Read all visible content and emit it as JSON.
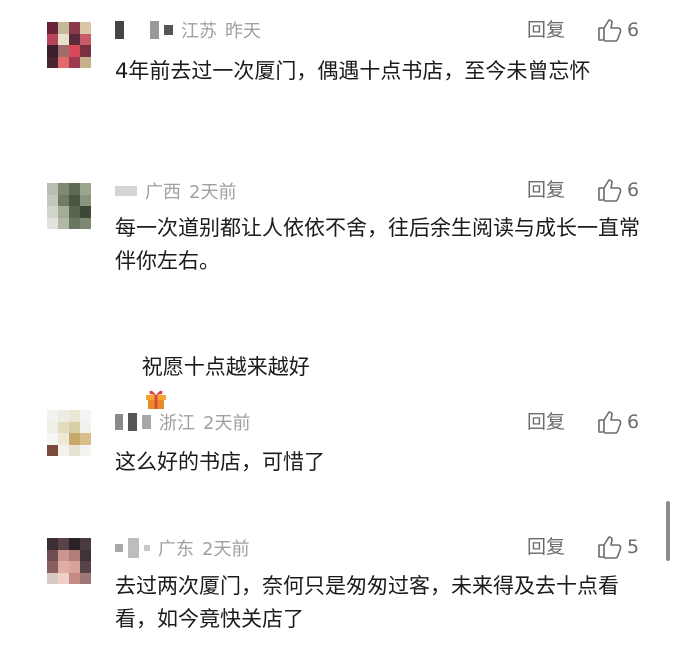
{
  "comments": [
    {
      "location": "江苏",
      "time": "昨天",
      "reply_label": "回复",
      "likes": "6",
      "text": "4年前去过一次厦门，偶遇十点书店，至今未曾忘怀"
    },
    {
      "location": "广西",
      "time": "2天前",
      "reply_label": "回复",
      "likes": "6",
      "text": "每一次道别都让人依依不舍，往后余生阅读与成长一直常伴你左右。",
      "text2": "祝愿十点越来越好"
    },
    {
      "location": "浙江",
      "time": "2天前",
      "reply_label": "回复",
      "likes": "6",
      "text": "这么好的书店，可惜了"
    },
    {
      "location": "广东",
      "time": "2天前",
      "reply_label": "回复",
      "likes": "5",
      "text": "去过两次厦门，奈何只是匆匆过客，未来得及去十点看看，如今竟快关店了"
    }
  ],
  "colors": {
    "meta_gray": "#a0a0a0",
    "action_gray": "#6b6b6b",
    "text": "#1b1b1b"
  }
}
